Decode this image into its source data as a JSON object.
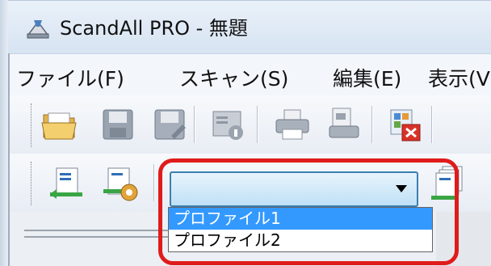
{
  "window": {
    "title": "ScandAll PRO - 無題"
  },
  "menu": {
    "items": [
      "ファイル(F)",
      "スキャン(S)",
      "編集(E)",
      "表示(V"
    ]
  },
  "toolbar1": {
    "icons": [
      "open-folder-icon",
      "save-icon",
      "save-as-icon",
      "properties-icon",
      "print-icon",
      "print-preview-icon",
      "delete-page-icon"
    ]
  },
  "toolbar2": {
    "icons": [
      "scan-to-view-icon",
      "scan-settings-icon",
      "batch-scan-icon"
    ],
    "profile_combo": {
      "value": "",
      "options": [
        "プロファイル1",
        "プロファイル2"
      ],
      "highlighted_index": 0
    }
  },
  "colors": {
    "highlight_border": "#e01b1b",
    "selected_option": "#3399ff"
  }
}
